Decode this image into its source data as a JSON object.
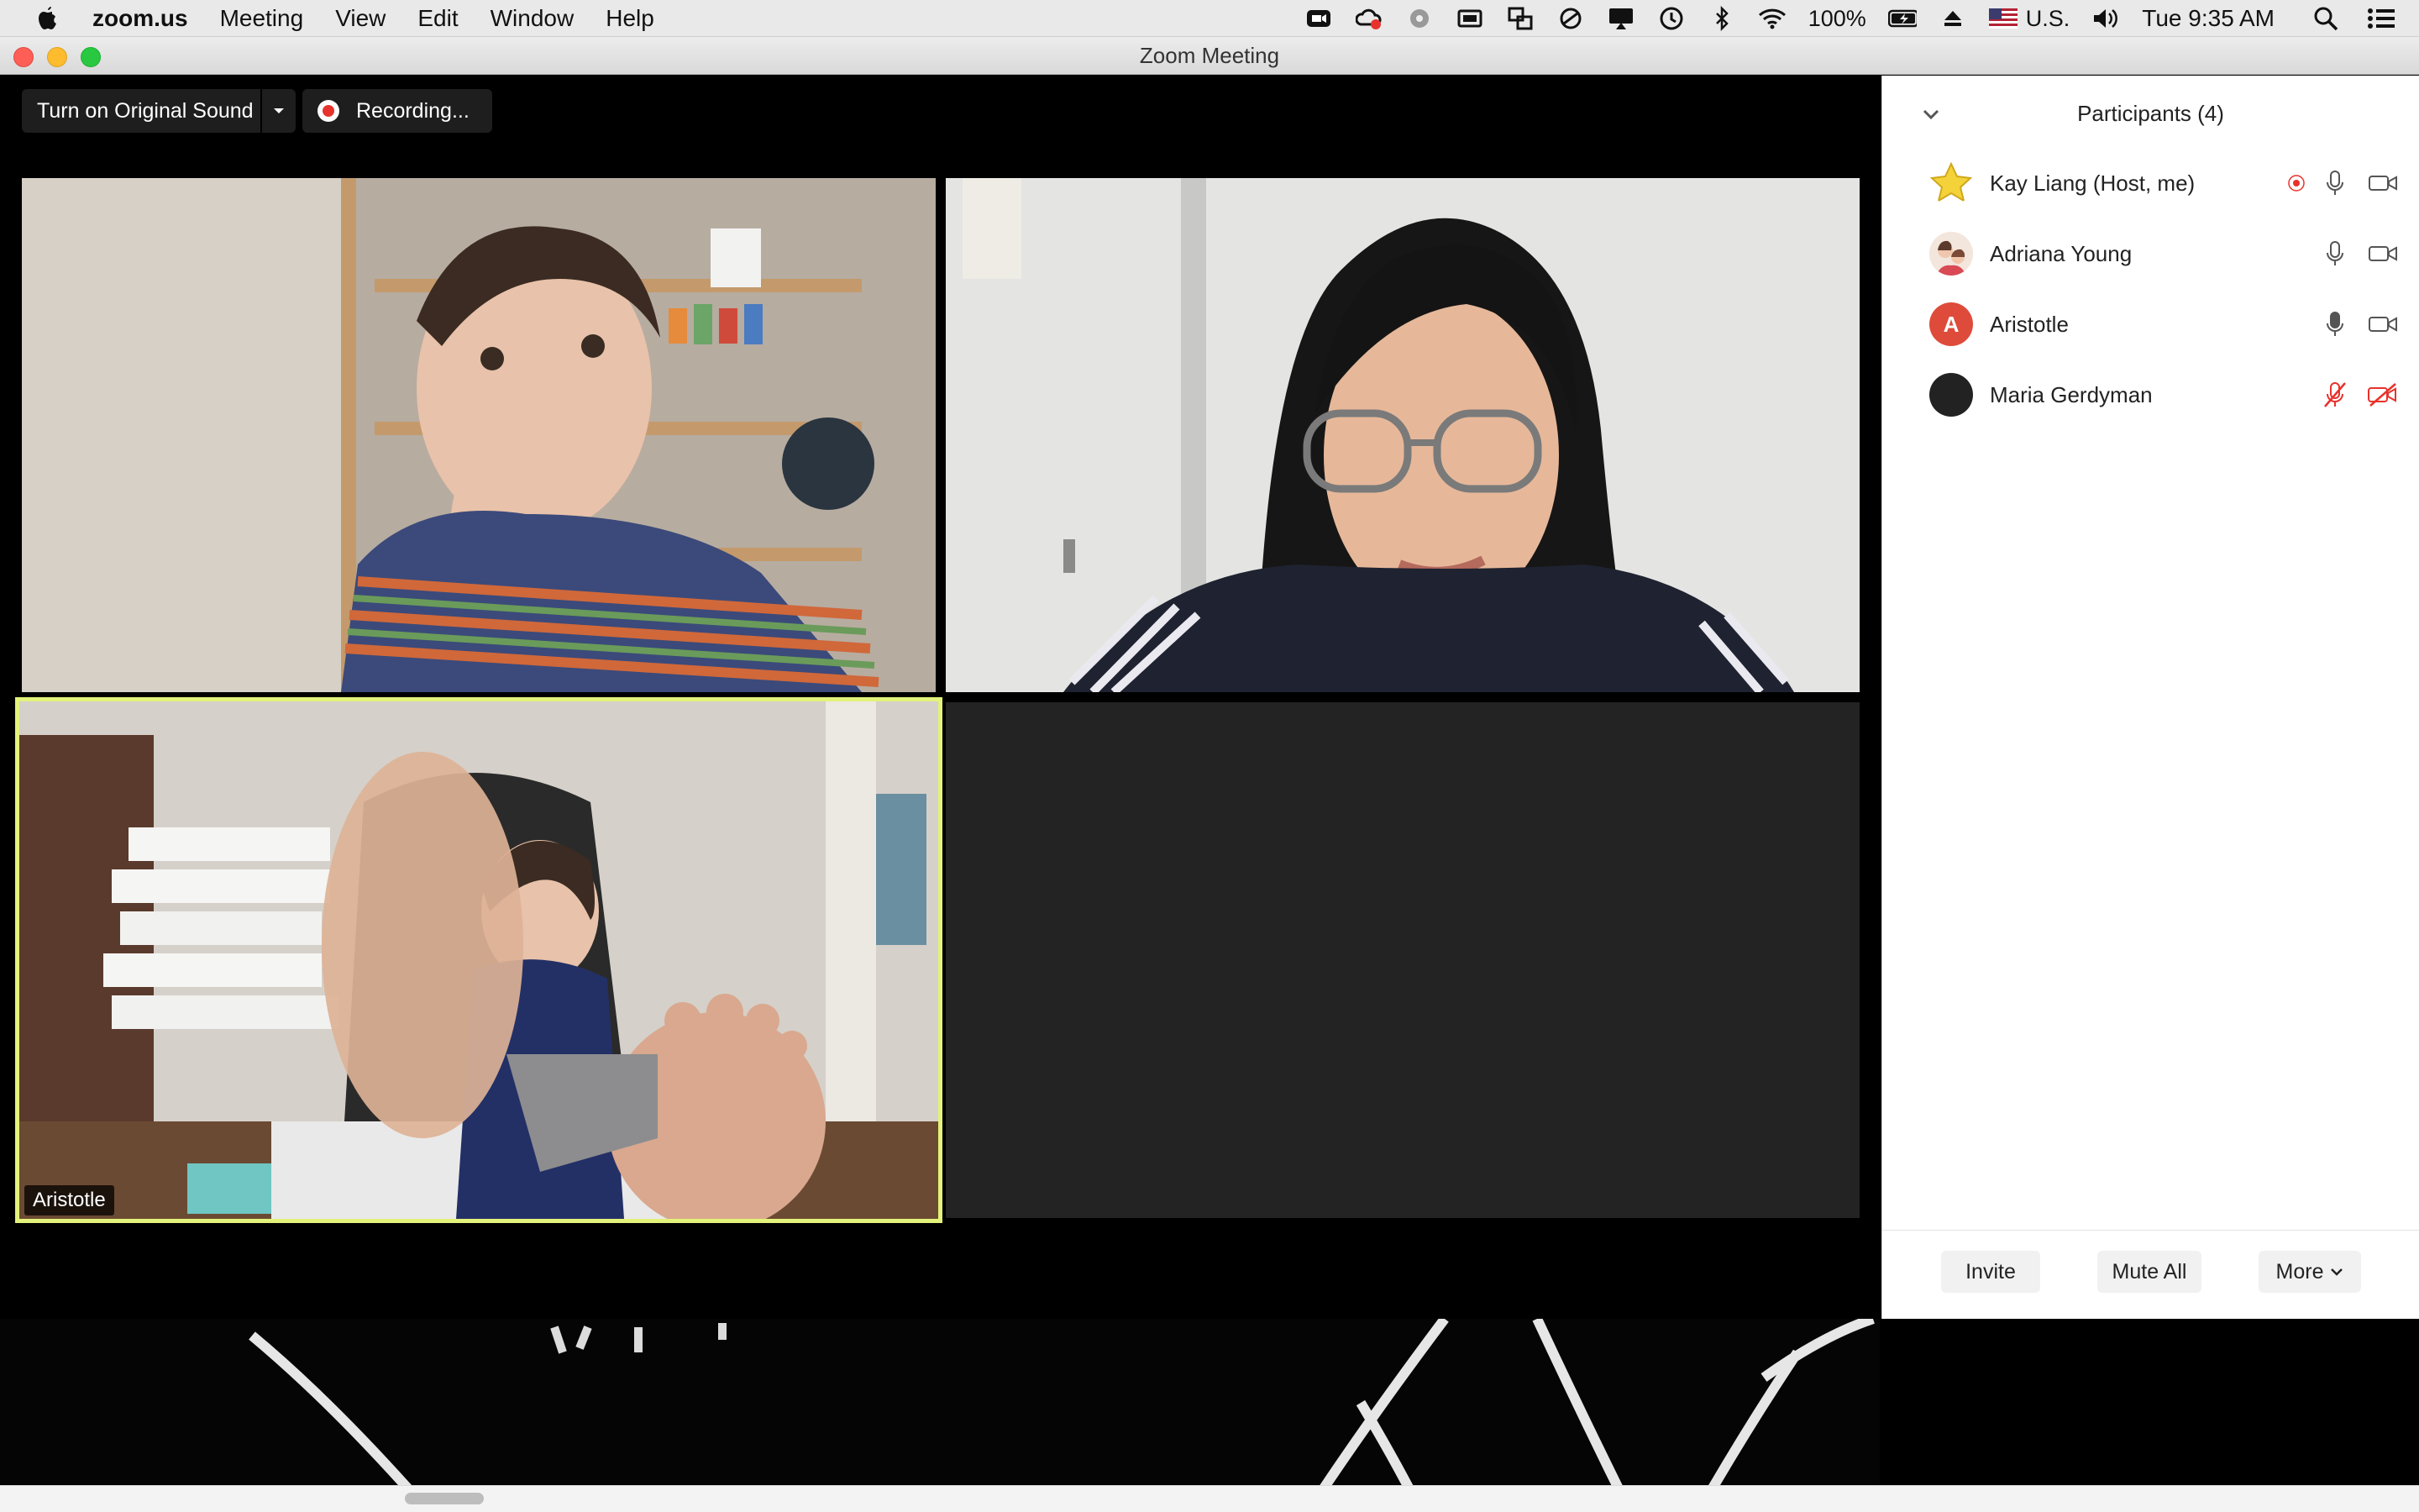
{
  "menubar": {
    "app": "zoom.us",
    "items": [
      "Meeting",
      "View",
      "Edit",
      "Window",
      "Help"
    ],
    "battery": "100%",
    "input_source": "U.S.",
    "clock": "Tue 9:35 AM"
  },
  "window": {
    "title": "Zoom Meeting"
  },
  "toolbar": {
    "original_sound_label": "Turn on Original Sound",
    "recording_label": "Recording..."
  },
  "videos": [
    {
      "name": ""
    },
    {
      "name": ""
    },
    {
      "name": "Aristotle",
      "active_speaker": true
    },
    {
      "name": ""
    }
  ],
  "participants": {
    "title": "Participants (4)",
    "list": [
      {
        "name": "Kay Liang (Host, me)",
        "avatar": "star",
        "recording": true,
        "muted": false,
        "video_off": false
      },
      {
        "name": "Adriana Young",
        "avatar": "photo",
        "recording": false,
        "muted": false,
        "video_off": false
      },
      {
        "name": "Aristotle",
        "avatar": "letter",
        "initial": "A",
        "recording": false,
        "muted": false,
        "video_off": false
      },
      {
        "name": "Maria Gerdyman",
        "avatar": "dark",
        "recording": false,
        "muted": true,
        "video_off": true
      }
    ],
    "invite_label": "Invite",
    "mute_all_label": "Mute All",
    "more_label": "More"
  },
  "colors": {
    "accent_red": "#e8322c",
    "active_speaker_border": "#e3f27a",
    "avatar_letter_bg": "#de4b3a"
  }
}
